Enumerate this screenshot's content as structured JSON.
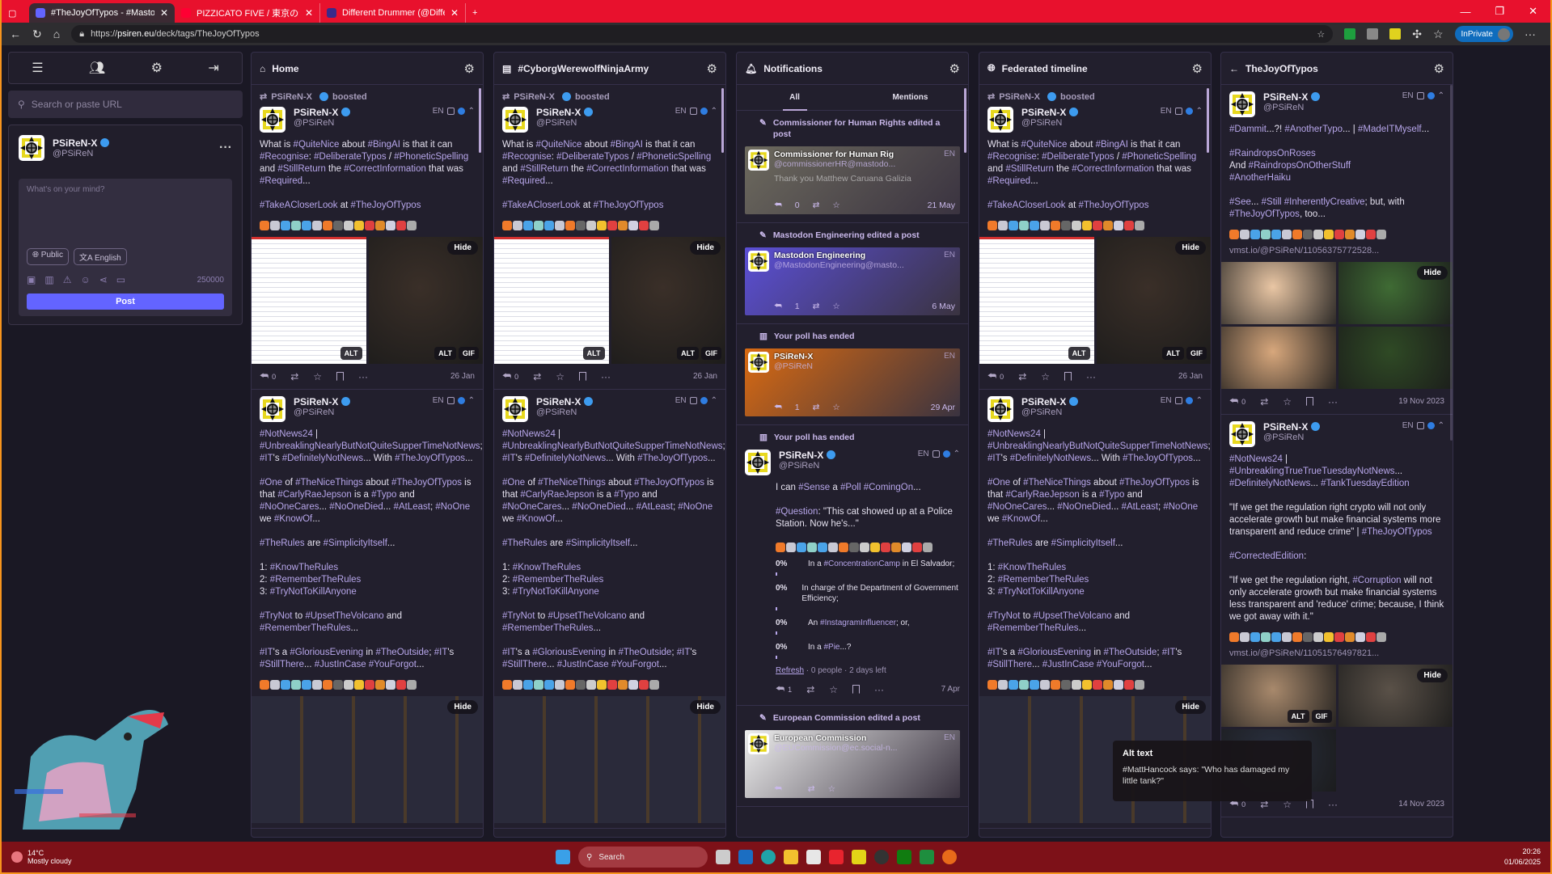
{
  "browser": {
    "tabs": [
      {
        "title": "#TheJoyOfTypos - #MastodonSpy",
        "active": true,
        "color": "#6364ff"
      },
      {
        "title": "PIZZICATO FIVE / 東京の合唱 - Yo",
        "active": false,
        "color": "#ff0033"
      },
      {
        "title": "Different Drummer (@DifferentD",
        "active": false,
        "color": "#3b2a8a"
      }
    ],
    "url_prefix": "https://",
    "url_host": "psiren.eu",
    "url_path": "/deck/tags/TheJoyOfTypos",
    "inprivate": "InPrivate"
  },
  "sidebar": {
    "search_placeholder": "Search or paste URL",
    "profile": {
      "name": "PSiReN-X",
      "handle": "@PSiReN"
    },
    "compose_placeholder": "What's on your mind?",
    "visibility": "Public",
    "language": "English",
    "char_count": "250000",
    "post_label": "Post"
  },
  "columns": [
    {
      "title": "Home",
      "icon": "home",
      "posts": [
        {
          "boosted_by": "PSiReN-X",
          "boosted_label": "boosted",
          "author": {
            "name": "PSiReN-X",
            "handle": "@PSiReN"
          },
          "lang": "EN",
          "body": [
            "What is #QuiteNice about #BingAI is that it can #Recognise: #DeliberateTypos / #PhoneticSpelling and #StillReturn the #CorrectInformation that was #Required...",
            "#TakeACloserLook at #TheJoyOfTypos"
          ],
          "media": {
            "hide": "Hide",
            "items": [
              {
                "kind": "shot",
                "badges": [
                  "ALT"
                ]
              },
              {
                "kind": "photo",
                "tone": "#3a2f28",
                "badges": [
                  "ALT",
                  "GIF"
                ]
              }
            ]
          },
          "replies": "0",
          "date": "26 Jan"
        },
        {
          "author": {
            "name": "PSiReN-X",
            "handle": "@PSiReN"
          },
          "lang": "EN",
          "body": [
            "#NotNews24 | #UnbreaklingNearlyButNotQuiteSupperTimeNotNews; #IT's #DefinitelyNotNews... With #TheJoyOfTypos...",
            "#One of #TheNiceThings about #TheJoyOfTypos is that #CarlyRaeJepson is a #Typo and #NoOneCares... #NoOneDied... #AtLeast; #NoOne we #KnowOf...",
            "#TheRules are #SimplicityItself...",
            "1: #KnowTheRules\n2: #RememberTheRules\n3: #TryNotToKillAnyone",
            "#TryNot to #UpsetTheVolcano and #RememberTheRules...",
            "#IT's a #GloriousEvening in #TheOutside; #IT's #StillThere... #JustInCase #YouForgot..."
          ],
          "media": {
            "hide": "Hide",
            "items": [
              {
                "kind": "dark",
                "badges": []
              }
            ]
          }
        }
      ]
    },
    {
      "title": "#CyborgWerewolfNinjaArmy",
      "icon": "list",
      "posts": [
        {
          "boosted_by": "PSiReN-X",
          "boosted_label": "boosted",
          "author": {
            "name": "PSiReN-X",
            "handle": "@PSiReN"
          },
          "lang": "EN",
          "body": [
            "What is #QuiteNice about #BingAI is that it can #Recognise: #DeliberateTypos / #PhoneticSpelling and #StillReturn the #CorrectInformation that was #Required...",
            "#TakeACloserLook at #TheJoyOfTypos"
          ],
          "media": {
            "hide": "Hide",
            "items": [
              {
                "kind": "shot",
                "badges": [
                  "ALT"
                ]
              },
              {
                "kind": "photo",
                "tone": "#3a2f28",
                "badges": [
                  "ALT",
                  "GIF"
                ]
              }
            ]
          },
          "replies": "0",
          "date": "26 Jan"
        },
        {
          "author": {
            "name": "PSiReN-X",
            "handle": "@PSiReN"
          },
          "lang": "EN",
          "body": [
            "#NotNews24 | #UnbreaklingNearlyButNotQuiteSupperTimeNotNews; #IT's #DefinitelyNotNews... With #TheJoyOfTypos...",
            "#One of #TheNiceThings about #TheJoyOfTypos is that #CarlyRaeJepson is a #Typo and #NoOneCares... #NoOneDied... #AtLeast; #NoOne we #KnowOf...",
            "#TheRules are #SimplicityItself...",
            "1: #KnowTheRules\n2: #RememberTheRules\n3: #TryNotToKillAnyone",
            "#TryNot to #UpsetTheVolcano and #RememberTheRules...",
            "#IT's a #GloriousEvening in #TheOutside; #IT's #StillThere... #JustInCase #YouForgot..."
          ],
          "media": {
            "hide": "Hide",
            "items": [
              {
                "kind": "dark",
                "badges": []
              }
            ]
          }
        }
      ]
    },
    {
      "title": "Notifications",
      "icon": "bell",
      "tabs": [
        "All",
        "Mentions"
      ],
      "notifications": [
        {
          "label": "Commissioner for Human Rights edited a post",
          "icon": "pencil",
          "card": {
            "name": "Commissioner for Human Rig",
            "handle": "@commissionerHR@mastodo...",
            "text": "Thank you Matthew Caruana Galizia",
            "replies": "0",
            "date": "21 May",
            "lang": "EN",
            "tone": "#6d6a5e"
          }
        },
        {
          "label": "Mastodon Engineering edited a post",
          "icon": "pencil",
          "card": {
            "name": "Mastodon Engineering",
            "handle": "@MastodonEngineering@masto...",
            "text": "",
            "replies": "1",
            "date": "6 May",
            "lang": "EN",
            "tone": "#5b4fd6"
          }
        },
        {
          "label": "Your poll has ended",
          "icon": "poll",
          "card": {
            "name": "PSiReN-X",
            "handle": "@PSiReN",
            "text": "",
            "replies": "1",
            "date": "29 Apr",
            "lang": "EN",
            "tone": "#d96a12"
          }
        },
        {
          "label": "Your poll has ended",
          "icon": "poll",
          "post": {
            "author": {
              "name": "PSiReN-X",
              "handle": "@PSiReN"
            },
            "lang": "EN",
            "body": [
              "I can #Sense a #Poll #ComingOn...",
              "#Question: \"This cat showed up at a Police Station. Now he's...\""
            ],
            "poll": {
              "options": [
                {
                  "pct": "0%",
                  "label": "In a #ConcentrationCamp in El Salvador;"
                },
                {
                  "pct": "0%",
                  "label": "In charge of the Department of Government Efficiency;"
                },
                {
                  "pct": "0%",
                  "label": "An #InstagramInfluencer; or,"
                },
                {
                  "pct": "0%",
                  "label": "In a #Pie...?"
                }
              ],
              "refresh": "Refresh",
              "summary": " · 0 people · 2 days left"
            },
            "replies": "1",
            "date": "7 Apr"
          }
        },
        {
          "label": "European Commission edited a post",
          "icon": "pencil",
          "card": {
            "name": "European Commission",
            "handle": "@EUCommission@ec.social-n...",
            "text": "",
            "replies": "",
            "date": "",
            "lang": "EN",
            "tone": "#eeeeee"
          }
        }
      ]
    },
    {
      "title": "Federated timeline",
      "icon": "globe",
      "posts": [
        {
          "boosted_by": "PSiReN-X",
          "boosted_label": "boosted",
          "author": {
            "name": "PSiReN-X",
            "handle": "@PSiReN"
          },
          "lang": "EN",
          "body": [
            "What is #QuiteNice about #BingAI is that it can #Recognise: #DeliberateTypos / #PhoneticSpelling and #StillReturn the #CorrectInformation that was #Required...",
            "#TakeACloserLook at #TheJoyOfTypos"
          ],
          "media": {
            "hide": "Hide",
            "items": [
              {
                "kind": "shot",
                "badges": [
                  "ALT"
                ]
              },
              {
                "kind": "photo",
                "tone": "#3a2f28",
                "badges": [
                  "ALT",
                  "GIF"
                ]
              }
            ]
          },
          "replies": "0",
          "date": "26 Jan"
        },
        {
          "author": {
            "name": "PSiReN-X",
            "handle": "@PSiReN"
          },
          "lang": "EN",
          "body": [
            "#NotNews24 | #UnbreaklingNearlyButNotQuiteSupperTimeNotNews; #IT's #DefinitelyNotNews... With #TheJoyOfTypos...",
            "#One of #TheNiceThings about #TheJoyOfTypos is that #CarlyRaeJepson is a #Typo and #NoOneCares... #NoOneDied... #AtLeast; #NoOne we #KnowOf...",
            "#TheRules are #SimplicityItself...",
            "1: #KnowTheRules\n2: #RememberTheRules\n3: #TryNotToKillAnyone",
            "#TryNot to #UpsetTheVolcano and #RememberTheRules...",
            "#IT's a #GloriousEvening in #TheOutside; #IT's #StillThere... #JustInCase #YouForgot..."
          ],
          "media": {
            "hide": "Hide",
            "items": [
              {
                "kind": "dark",
                "badges": []
              }
            ]
          }
        }
      ]
    },
    {
      "title": "TheJoyOfTypos",
      "icon": "back",
      "posts": [
        {
          "author": {
            "name": "PSiReN-X",
            "handle": "@PSiReN"
          },
          "lang": "EN",
          "body": [
            "#Dammit...?! #AnotherTypo... | #MadeITMyself...",
            "#RaindropsOnRoses\nAnd #RaindropsOnOtherStuff\n#AnotherHaiku",
            "#See... #Still #InherentlyCreative; but, with #TheJoyOfTypos, too..."
          ],
          "link": "vmst.io/@PSiReN/11056375772528...",
          "media": {
            "hide": "Hide",
            "items": [
              {
                "kind": "photo",
                "tone": "#e9c6a4",
                "badges": []
              },
              {
                "kind": "photo",
                "tone": "#3f6b34",
                "badges": []
              },
              {
                "kind": "photo",
                "tone": "#d7a77c",
                "badges": []
              },
              {
                "kind": "photo",
                "tone": "#2f4a25",
                "badges": []
              }
            ]
          },
          "replies": "0",
          "date": "19 Nov 2023"
        },
        {
          "author": {
            "name": "PSiReN-X",
            "handle": "@PSiReN"
          },
          "lang": "EN",
          "body": [
            "#NotNews24 |\n#UnbreaklingTrueTrueTuesdayNotNews...\n#DefinitelyNotNews... #TankTuesdayEdition",
            "\"If we get the regulation right crypto will not only accelerate growth but make financial systems more transparent and reduce crime\" | #TheJoyOfTypos",
            "#CorrectedEdition:",
            "\"If we get the regulation right, #Corruption will not only accelerate growth but make financial systems less transparent and 'reduce' crime; because, I think we got away with it.\""
          ],
          "link": "vmst.io/@PSiReN/11051576497821...",
          "media": {
            "hide": "Hide",
            "items": [
              {
                "kind": "photo",
                "tone": "#a8896c",
                "badges": [
                  "ALT",
                  "GIF"
                ]
              },
              {
                "kind": "photo",
                "tone": "#5a5148",
                "badges": []
              },
              {
                "kind": "photo",
                "tone": "#2a3040",
                "badges": []
              }
            ]
          },
          "replies": "0",
          "date": "14 Nov 2023"
        }
      ]
    }
  ],
  "tooltip": {
    "title": "Alt text",
    "text": "#MattHancock says: \"Who has damaged my little tank?\""
  },
  "taskbar": {
    "temp": "14°C",
    "weather": "Mostly cloudy",
    "search": "Search",
    "time": "20:26",
    "date": "01/06/2025"
  }
}
